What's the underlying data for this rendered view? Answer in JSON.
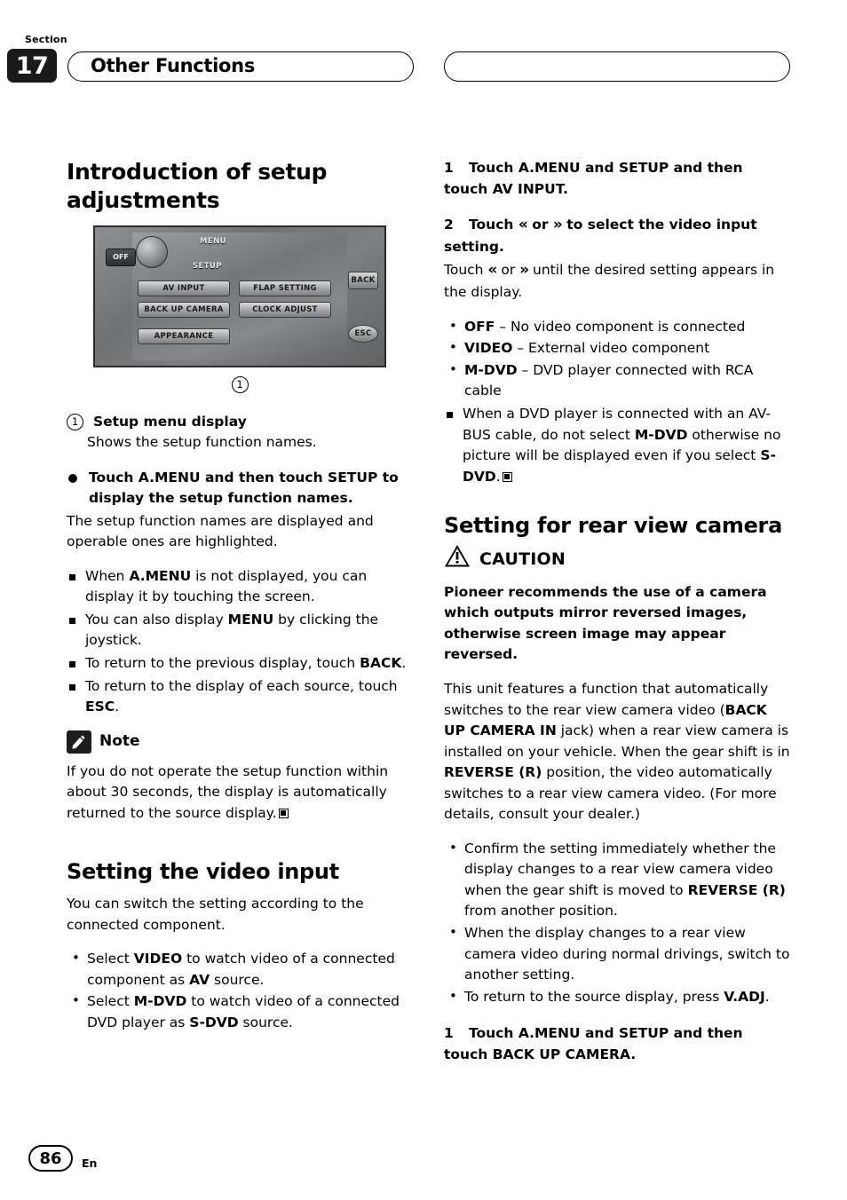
{
  "header": {
    "section_label": "Section",
    "section_number": "17",
    "title": "Other Functions"
  },
  "footer": {
    "page_number": "86",
    "language": "En"
  },
  "left_column": {
    "heading": "Introduction of setup adjustments",
    "device_image": {
      "menu_label": "MENU",
      "setup_label": "SETUP",
      "off_label": "OFF",
      "buttons": [
        "AV INPUT",
        "FLAP SETTING",
        "BACK UP CAMERA",
        "CLOCK ADJUST",
        "APPEARANCE",
        "BACK",
        "ESC"
      ],
      "callout": "1"
    },
    "callout_number": "1",
    "callout_title": "Setup menu display",
    "callout_desc": "Shows the setup function names.",
    "bullet_heading": "Touch A.MENU and then touch SETUP to display the setup function names.",
    "para1": "The setup function names are displayed and operable ones are highlighted.",
    "notes": [
      {
        "prefix": "When ",
        "bold": "A.MENU",
        "suffix": " is not displayed, you can display it by touching the screen."
      },
      {
        "prefix": "You can also display ",
        "bold": "MENU",
        "suffix": " by clicking the joystick."
      },
      {
        "prefix": "To return to the previous display, touch ",
        "bold": "BACK",
        "suffix": "."
      },
      {
        "prefix": "To return to the display of each source, touch ",
        "bold": "ESC",
        "suffix": "."
      }
    ],
    "note_label": "Note",
    "note_text": "If you do not operate the setup function within about 30 seconds, the display is automatically returned to the source display.",
    "video_heading": "Setting the video input",
    "video_para": "You can switch the setting according to the connected component.",
    "video_bullets": [
      {
        "p1": "Select ",
        "b1": "VIDEO",
        "p2": " to watch video of a connected component as ",
        "b2": "AV",
        "p3": " source."
      },
      {
        "p1": "Select ",
        "b1": "M-DVD",
        "p2": " to watch video of a connected DVD player as ",
        "b2": "S-DVD",
        "p3": " source."
      }
    ]
  },
  "right_column": {
    "step1": {
      "num": "1",
      "text": "Touch A.MENU and SETUP and then touch AV INPUT."
    },
    "step2": {
      "num": "2",
      "pre": "Touch ",
      "mid": " or ",
      "post": " to select the video input setting."
    },
    "step2_body": {
      "pre": "Touch ",
      "mid": " or ",
      "post": " until the desired setting appears in the display."
    },
    "setting_bullets": [
      {
        "bold": "OFF",
        "rest": " – No video component is connected"
      },
      {
        "bold": "VIDEO",
        "rest": " – External video component"
      },
      {
        "bold": "M-DVD",
        "rest": " – DVD player connected with RCA cable"
      }
    ],
    "note": {
      "p1": "When a DVD player is connected with an AV-BUS cable, do not select ",
      "b1": "M-DVD",
      "p2": " otherwise no picture will be displayed even if you select ",
      "b2": "S-DVD",
      "p3": "."
    },
    "camera_heading": "Setting for rear view camera",
    "caution_label": "CAUTION",
    "caution_text": "Pioneer recommends the use of a camera which outputs mirror reversed images, otherwise screen image may appear reversed.",
    "camera_para": {
      "p1": "This unit features a function that automatically switches to the rear view camera video (",
      "b1": "BACK UP CAMERA IN",
      "p2": " jack) when a rear view camera is installed on your vehicle. When the gear shift is in ",
      "b2": "REVERSE (R)",
      "p3": " position, the video automatically switches to a rear view camera video. (For more details, consult your dealer.)"
    },
    "camera_bullets": [
      {
        "p1": "Confirm the setting immediately whether the display changes to a rear view camera video when the gear shift is moved to ",
        "b1": "REVERSE (R)",
        "p2": " from another position."
      },
      {
        "p1": "When the display changes to a rear view camera video during normal drivings, switch to another setting.",
        "b1": "",
        "p2": ""
      },
      {
        "p1": "To return to the source display, press ",
        "b1": "V.ADJ",
        "p2": "."
      }
    ],
    "step3": {
      "num": "1",
      "text": "Touch A.MENU and SETUP and then touch BACK UP CAMERA."
    }
  },
  "icons": {
    "note": "pencil-note-icon",
    "caution": "warning-triangle-icon",
    "rewind": "double-left-arrow-icon",
    "forward": "double-right-arrow-icon",
    "endmark": "end-of-section-square-icon"
  }
}
